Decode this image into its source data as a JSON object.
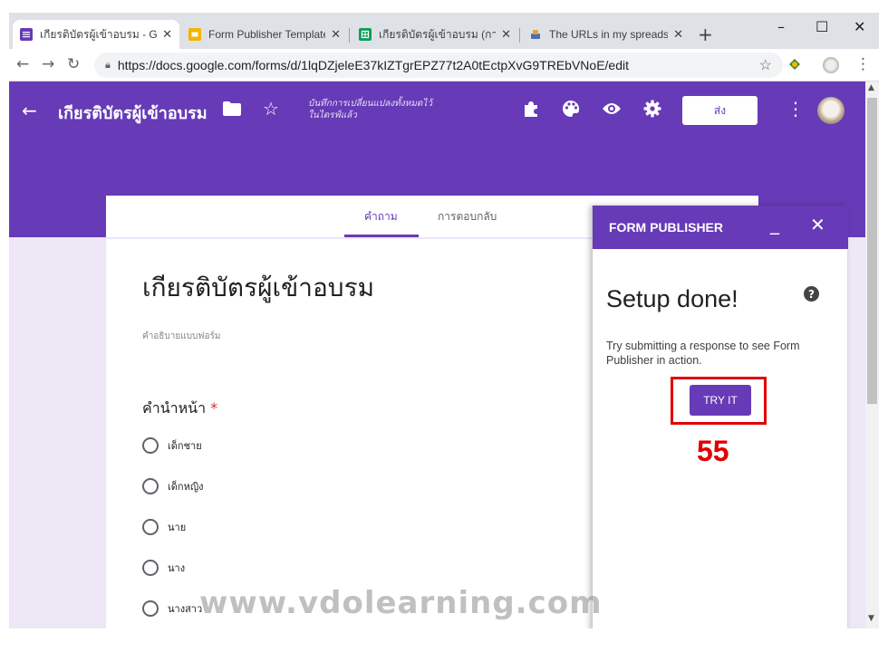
{
  "browser": {
    "tabs": [
      {
        "title": "เกียรติบัตรผู้เข้าอบรม - Goog",
        "icon": "forms-icon"
      },
      {
        "title": "Form Publisher Template",
        "icon": "slides-icon"
      },
      {
        "title": "เกียรติบัตรผู้เข้าอบรม (การตอ",
        "icon": "sheets-icon"
      },
      {
        "title": "The URLs in my spreadshe",
        "icon": "script-icon"
      }
    ],
    "close_glyph": "✕",
    "new_tab": "+",
    "window_controls": {
      "minimize": "–",
      "maximize": "☐",
      "close": "✕"
    },
    "url": "https://docs.google.com/forms/d/1lqDZjeleE37kIZTgrEPZ77t2A0tEctpXvG9TREbVNoE/edit"
  },
  "forms_header": {
    "title": "เกียรติบัตรผู้เข้าอบรม",
    "saved_status_line1": "บันทึกการเปลี่ยนแปลงทั้งหมดไว้",
    "saved_status_line2": "ในไดรฟ์แล้ว",
    "send_label": "ส่ง",
    "accent": "#673ab7"
  },
  "form_tabs": {
    "questions": "คำถาม",
    "responses": "การตอบกลับ"
  },
  "form": {
    "title": "เกียรติบัตรผู้เข้าอบรม",
    "description_placeholder": "คำอธิบายแบบฟอร์ม",
    "question": {
      "title": "คำนำหน้า",
      "required_mark": "*",
      "options": [
        "เด็กชาย",
        "เด็กหญิง",
        "นาย",
        "นาง",
        "นางสาว"
      ]
    }
  },
  "publisher_panel": {
    "title": "FORM PUBLISHER",
    "heading": "Setup done!",
    "help": "?",
    "message": "Try submitting a response to see Form Publisher in action.",
    "button_label": "TRY IT",
    "annotation_number": "55",
    "annotation_color": "#e00000"
  },
  "watermark": "www.vdolearning.com"
}
